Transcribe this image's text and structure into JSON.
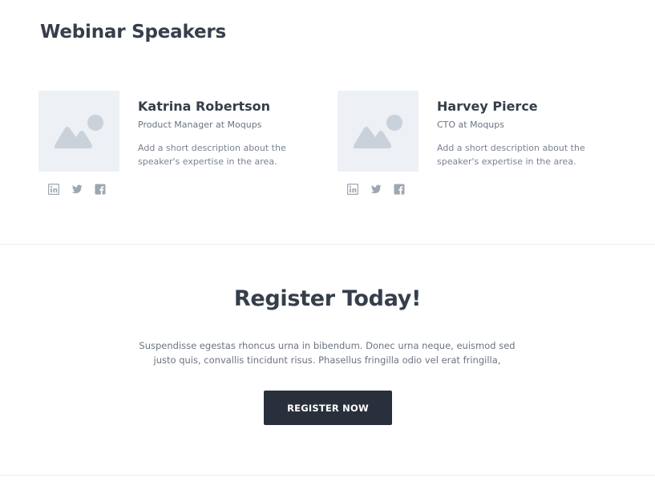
{
  "section": {
    "title": "Webinar Speakers"
  },
  "speakers": [
    {
      "name": "Katrina Robertson",
      "role": "Product Manager at Moqups",
      "description": "Add a short description about the speaker's expertise in the area.",
      "photo_icon": "image-placeholder-icon",
      "socials": [
        "linkedin-icon",
        "twitter-icon",
        "facebook-icon"
      ]
    },
    {
      "name": "Harvey Pierce",
      "role": "CTO at Moqups",
      "description": "Add a short description about the speaker's expertise in the area.",
      "photo_icon": "image-placeholder-icon",
      "socials": [
        "linkedin-icon",
        "twitter-icon",
        "facebook-icon"
      ]
    }
  ],
  "register": {
    "title": "Register Today!",
    "text": "Suspendisse egestas rhoncus urna in bibendum. Donec urna neque, euismod sed justo quis, convallis tincidunt risus. Phasellus fringilla odio vel erat fringilla,",
    "button_label": "REGISTER NOW"
  },
  "colors": {
    "heading": "#363e4b",
    "body_text": "#6b7380",
    "placeholder_bg": "#edf0f4",
    "placeholder_shape": "#c9d1db",
    "social_icon": "#9ea6b2",
    "button_bg": "#2a303b",
    "divider": "#eceef1"
  }
}
